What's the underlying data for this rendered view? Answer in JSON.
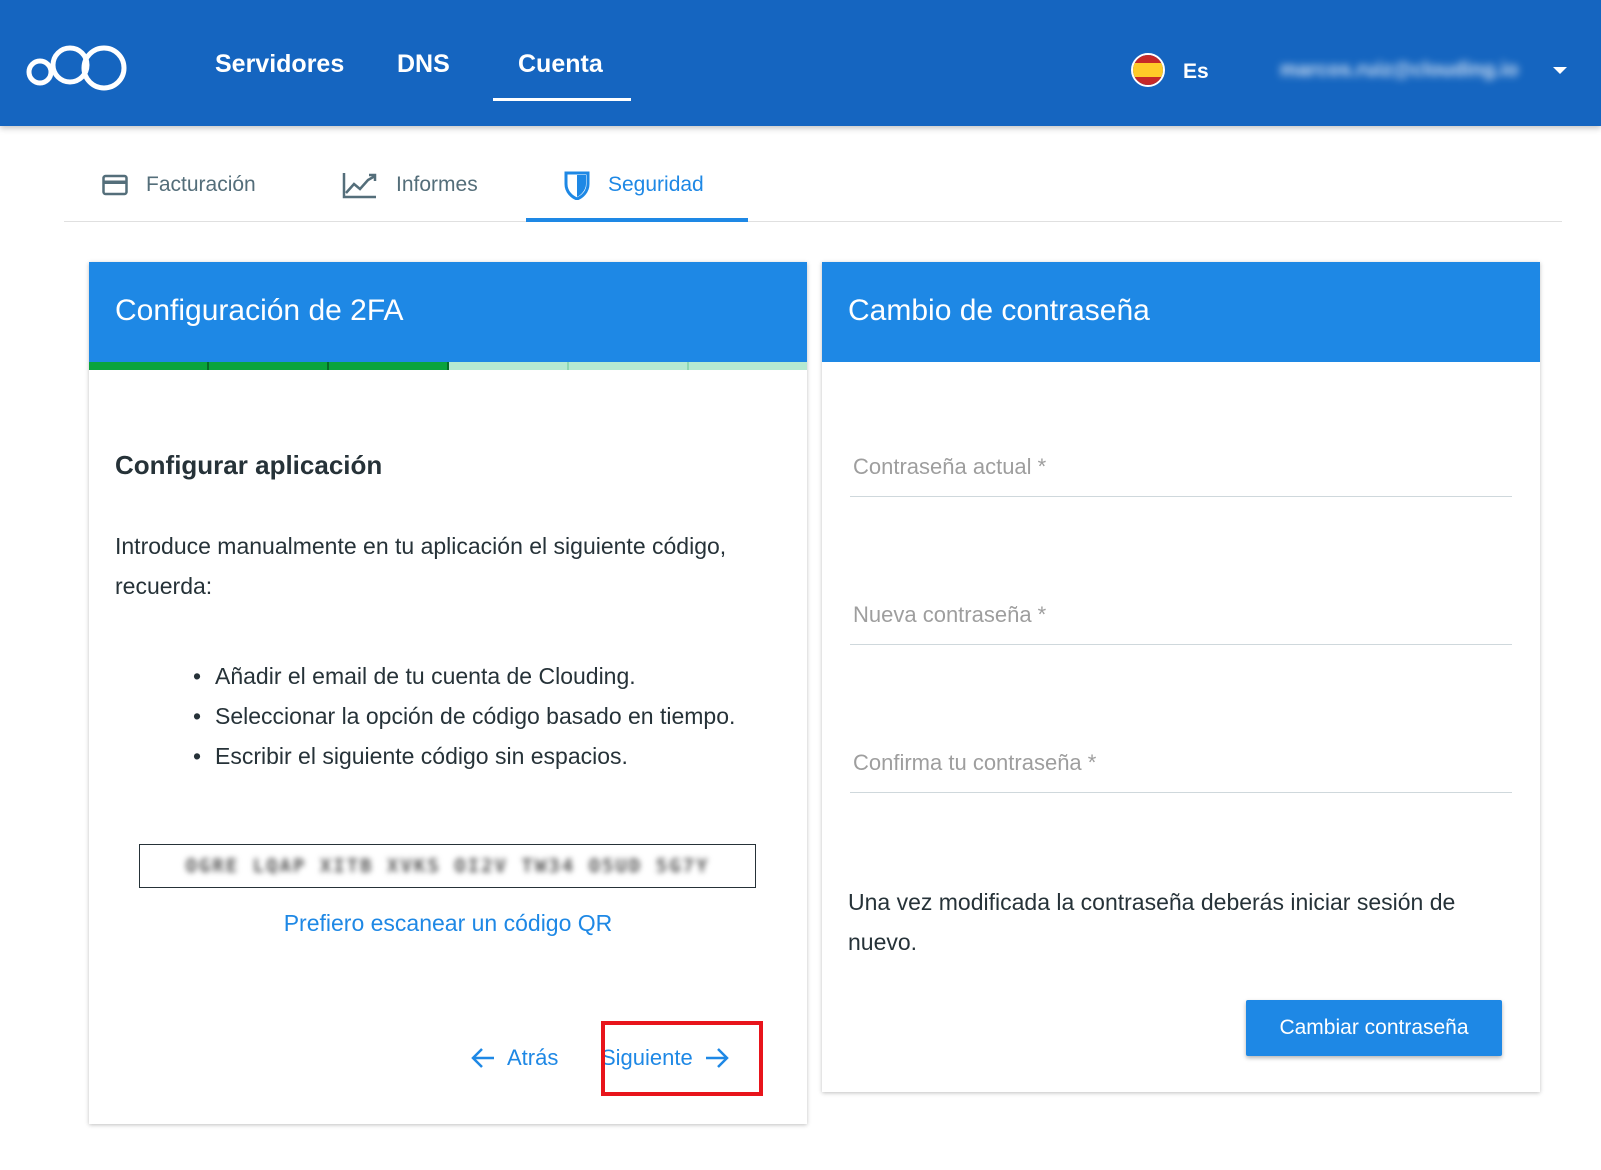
{
  "topbar": {
    "nav": [
      {
        "label": "Servidores"
      },
      {
        "label": "DNS"
      },
      {
        "label": "Cuenta",
        "active": true
      }
    ],
    "language": "Es",
    "user_email": "marcos.ruiz@clouding.io",
    "accent_color": "#1565c0"
  },
  "subtabs": [
    {
      "label": "Facturación",
      "icon": "credit-card-icon"
    },
    {
      "label": "Informes",
      "icon": "chart-line-icon"
    },
    {
      "label": "Seguridad",
      "icon": "shield-icon",
      "active": true
    }
  ],
  "twofa": {
    "title": "Configuración de 2FA",
    "steps_done": 3,
    "steps_total": 6,
    "section_title": "Configurar aplicación",
    "intro": "Introduce manualmente en tu aplicación el siguiente código, recuerda:",
    "bullets": [
      "Añadir el email de tu cuenta de Clouding.",
      "Seleccionar la opción de código basado en tiempo.",
      "Escribir el siguiente código sin espacios."
    ],
    "secret_code": "OGRE LQAP XITB XVKS OI2V TW34 O5UD 5G7Y",
    "qr_link": "Prefiero escanear un código QR",
    "back_label": "Atrás",
    "next_label": "Siguiente"
  },
  "password": {
    "title": "Cambio de contraseña",
    "current_placeholder": "Contraseña actual *",
    "new_placeholder": "Nueva contraseña *",
    "confirm_placeholder": "Confirma tu contraseña *",
    "note": "Una vez modificada la contraseña deberás iniciar sesión de nuevo.",
    "submit_label": "Cambiar contraseña"
  }
}
